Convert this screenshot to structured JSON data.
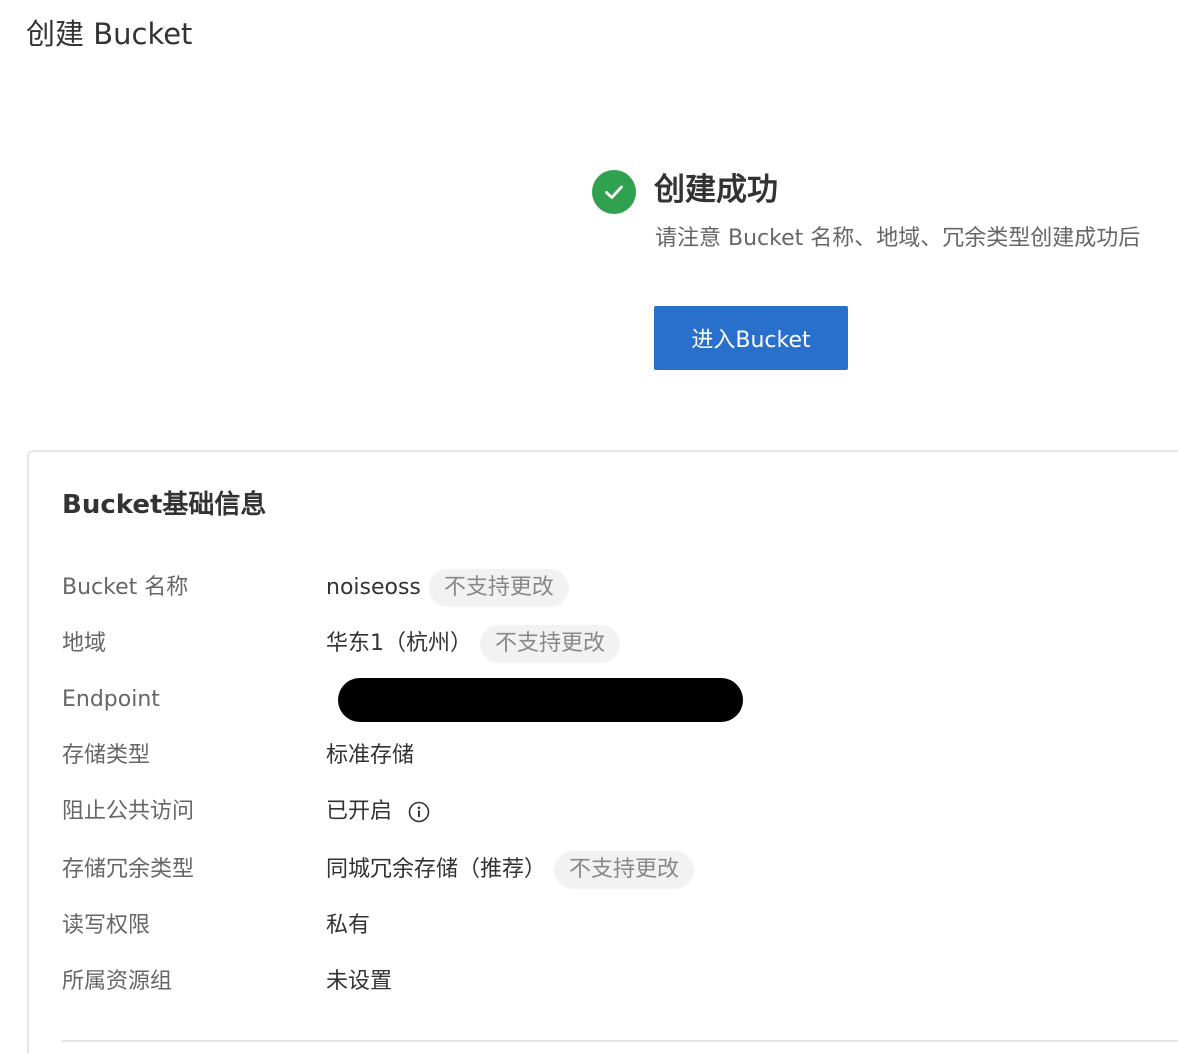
{
  "page": {
    "title": "创建 Bucket"
  },
  "result": {
    "title": "创建成功",
    "description": "请注意 Bucket 名称、地域、冗余类型创建成功后",
    "enter_button_label": "进入Bucket",
    "icon": "check-circle-icon",
    "success_color": "#30a14e",
    "button_color": "#2970cc"
  },
  "info": {
    "title": "Bucket基础信息",
    "rows": [
      {
        "label": "Bucket 名称",
        "value": "noiseoss",
        "tag": "不支持更改"
      },
      {
        "label": "地域",
        "value": "华东1（杭州）",
        "tag": "不支持更改"
      },
      {
        "label": "Endpoint"
      },
      {
        "label": "存储类型",
        "value": "标准存储"
      },
      {
        "label": "阻止公共访问",
        "value": "已开启",
        "icon": "info-icon"
      },
      {
        "label": "存储冗余类型",
        "value": "同城冗余存储（推荐）",
        "tag": "不支持更改"
      },
      {
        "label": "读写权限",
        "value": "私有"
      },
      {
        "label": "所属资源组",
        "value": "未设置"
      }
    ]
  }
}
